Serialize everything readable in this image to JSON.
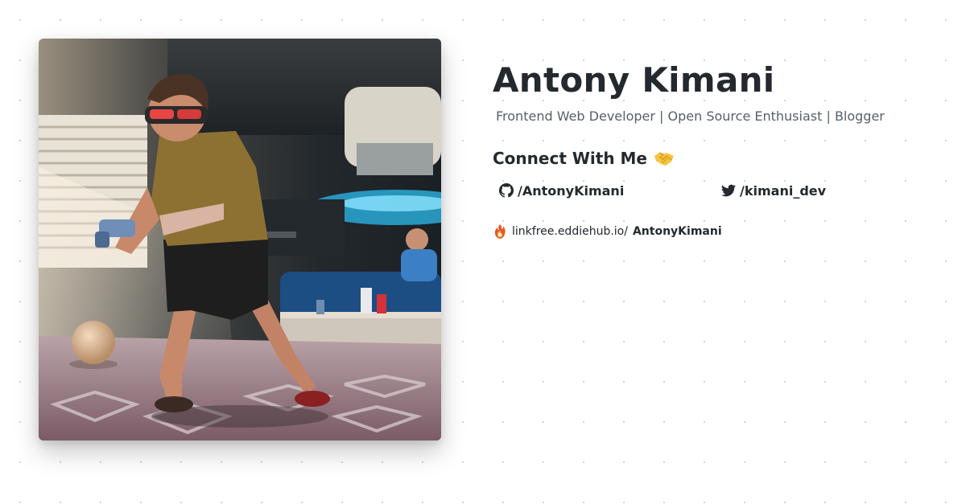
{
  "profile": {
    "name": "Antony Kimani",
    "tagline": "Frontend Web Developer | Open Source Enthusiast | Blogger"
  },
  "connect": {
    "heading": "Connect With Me",
    "icon": "handshake-emoji"
  },
  "socials": [
    {
      "platform": "github",
      "icon": "github-icon",
      "label": "/AntonyKimani"
    },
    {
      "platform": "twitter",
      "icon": "twitter-icon",
      "label": "/kimani_dev"
    }
  ],
  "linkfree": {
    "icon": "linkfree-icon",
    "domain": "linkfree.eddiehub.io/",
    "username": "AntonyKimani"
  },
  "colors": {
    "text": "#24292f",
    "muted": "#57606a",
    "dots": "#cfd3d8"
  }
}
